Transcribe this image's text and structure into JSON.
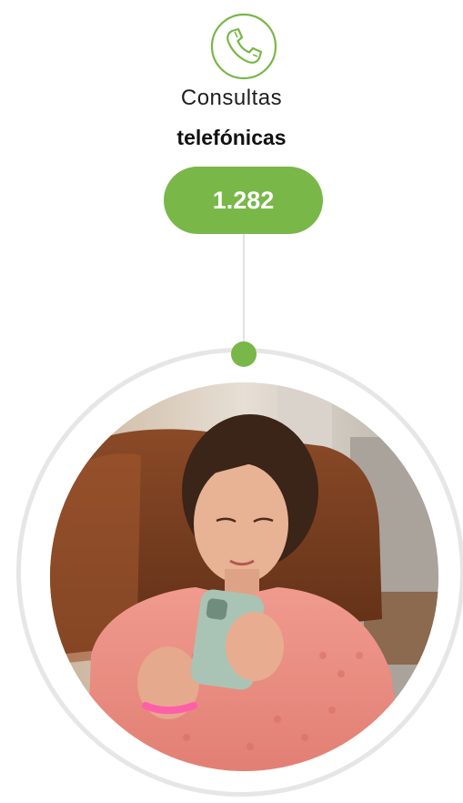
{
  "stat": {
    "icon": "phone-icon",
    "title_line1": "Consultas",
    "title_line2": "telefónicas",
    "value": "1.282"
  },
  "colors": {
    "accent": "#78b748",
    "ring": "#e6e6e6",
    "connector": "#e3e3e3",
    "text": "#1e1e1e"
  },
  "photo": {
    "subject": "woman-using-smartphone-photo"
  }
}
